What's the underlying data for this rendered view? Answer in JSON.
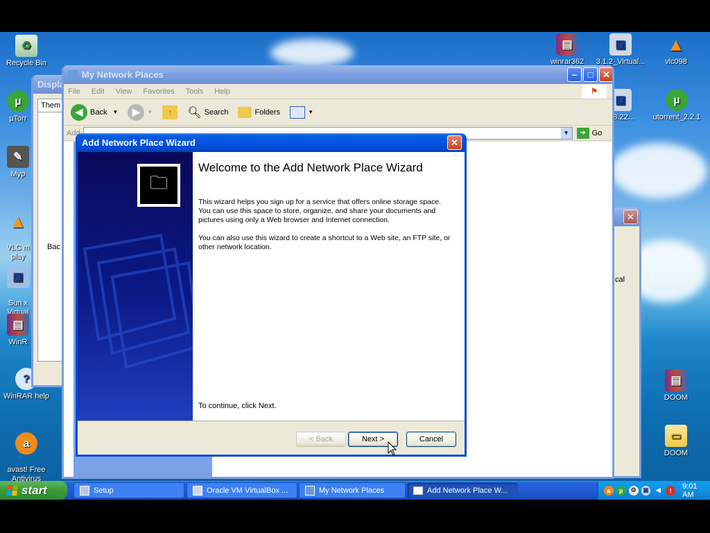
{
  "desktop": {
    "icons_left": [
      {
        "label": "Recycle Bin",
        "icon": "recycle-bin-icon"
      },
      {
        "label": "µTorr",
        "icon": "utorrent-icon"
      },
      {
        "label": "Myp",
        "icon": "mypaint-icon"
      },
      {
        "label": "VLC m\nplay",
        "icon": "vlc-icon"
      },
      {
        "label": "Sun x\nVirtual",
        "icon": "virtualbox-icon"
      },
      {
        "label": "WinR",
        "icon": "winrar-icon"
      },
      {
        "label": "WinRAR help",
        "icon": "help-icon"
      },
      {
        "label": "avast! Free\nAntivirus",
        "icon": "avast-icon"
      }
    ],
    "icons_right": [
      {
        "label": "winrar362",
        "icon": "winrar-icon"
      },
      {
        "label": "3.1.2_Virtual...",
        "icon": "virtualbox-icon"
      },
      {
        "label": "vlc098",
        "icon": "vlc-icon"
      },
      {
        "label": "2.8.22...",
        "icon": "virtualbox-icon"
      },
      {
        "label": "utorrent_2.2.1",
        "icon": "utorrent-icon"
      },
      {
        "label": "DOOM",
        "icon": "winrar-icon"
      },
      {
        "label": "DOOM",
        "icon": "folder-icon"
      }
    ]
  },
  "display_window": {
    "title": "Displa",
    "tab": "Them",
    "label_bac": "Bac"
  },
  "explorer": {
    "title": "My Network Places",
    "menu": [
      "File",
      "Edit",
      "View",
      "Favorites",
      "Tools",
      "Help"
    ],
    "toolbar": {
      "back": "Back",
      "search": "Search",
      "folders": "Folders"
    },
    "address_label": "Add",
    "go": "Go"
  },
  "right_window": {
    "label": "cal"
  },
  "wizard": {
    "title": "Add Network Place Wizard",
    "heading": "Welcome to the Add Network Place Wizard",
    "para1": "This wizard helps you sign up for a service that offers online storage space. You can use this space to store, organize, and share your documents and pictures using only a Web browser and Internet connection.",
    "para2": "You can also use this wizard to create a shortcut to a Web site, an FTP site, or other network location.",
    "continue": "To continue, click Next.",
    "buttons": {
      "back": "< Back",
      "next": "Next >",
      "cancel": "Cancel"
    }
  },
  "taskbar": {
    "start": "start",
    "tasks": [
      {
        "label": "Setup",
        "active": false
      },
      {
        "label": "Oracle VM VirtualBox ...",
        "active": false
      },
      {
        "label": "My Network Places",
        "active": false
      },
      {
        "label": "Add Network Place W...",
        "active": true
      }
    ],
    "clock": "9:01 AM"
  }
}
